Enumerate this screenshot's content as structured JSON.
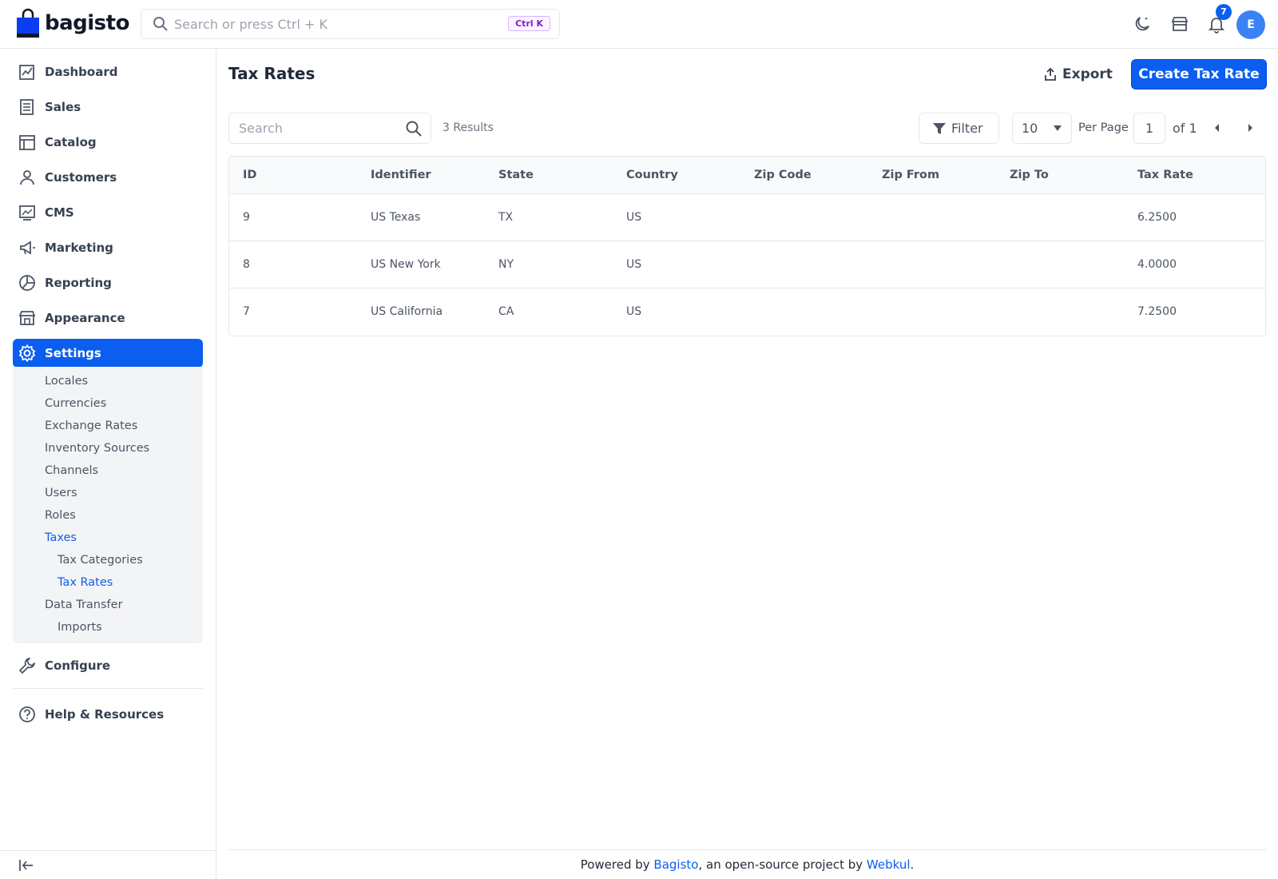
{
  "app": {
    "logo_text": "bagisto"
  },
  "header": {
    "search_placeholder": "Search or press Ctrl + K",
    "search_shortcut": "Ctrl K",
    "notification_count": "7",
    "avatar_initial": "E"
  },
  "sidebar": {
    "items": [
      {
        "label": "Dashboard",
        "icon": "dashboard-icon"
      },
      {
        "label": "Sales",
        "icon": "sales-icon"
      },
      {
        "label": "Catalog",
        "icon": "catalog-icon"
      },
      {
        "label": "Customers",
        "icon": "customers-icon"
      },
      {
        "label": "CMS",
        "icon": "cms-icon"
      },
      {
        "label": "Marketing",
        "icon": "marketing-icon"
      },
      {
        "label": "Reporting",
        "icon": "reporting-icon"
      },
      {
        "label": "Appearance",
        "icon": "appearance-icon"
      },
      {
        "label": "Settings",
        "icon": "gear-icon",
        "active": true
      },
      {
        "label": "Configure",
        "icon": "wrench-icon"
      },
      {
        "label": "Help & Resources",
        "icon": "help-icon"
      }
    ],
    "settings_sub": [
      {
        "label": "Locales"
      },
      {
        "label": "Currencies"
      },
      {
        "label": "Exchange Rates"
      },
      {
        "label": "Inventory Sources"
      },
      {
        "label": "Channels"
      },
      {
        "label": "Users"
      },
      {
        "label": "Roles"
      },
      {
        "label": "Taxes",
        "highlight": true
      },
      {
        "label": "Tax Categories",
        "nested": true
      },
      {
        "label": "Tax Rates",
        "nested": true,
        "highlight": true
      },
      {
        "label": "Data Transfer"
      },
      {
        "label": "Imports",
        "nested": true
      }
    ]
  },
  "page": {
    "title": "Tax Rates",
    "export_label": "Export",
    "create_label": "Create Tax Rate"
  },
  "datagrid": {
    "search_placeholder": "Search",
    "results_text": "3 Results",
    "filter_label": "Filter",
    "per_page_value": "10",
    "per_page_label": "Per Page",
    "current_page": "1",
    "of_label": "of 1",
    "columns": [
      "ID",
      "Identifier",
      "State",
      "Country",
      "Zip Code",
      "Zip From",
      "Zip To",
      "Tax Rate"
    ],
    "rows": [
      [
        "9",
        "US Texas",
        "TX",
        "US",
        "",
        "",
        "",
        "6.2500"
      ],
      [
        "8",
        "US New York",
        "NY",
        "US",
        "",
        "",
        "",
        "4.0000"
      ],
      [
        "7",
        "US California",
        "CA",
        "US",
        "",
        "",
        "",
        "7.2500"
      ]
    ]
  },
  "footer": {
    "prefix": "Powered by ",
    "link1": "Bagisto",
    "middle": ", an open-source project by ",
    "link2": "Webkul",
    "suffix": "."
  },
  "colors": {
    "accent": "#0b5ef0",
    "text": "#1f2937",
    "muted": "#4b5563",
    "border": "#e5e7eb"
  }
}
